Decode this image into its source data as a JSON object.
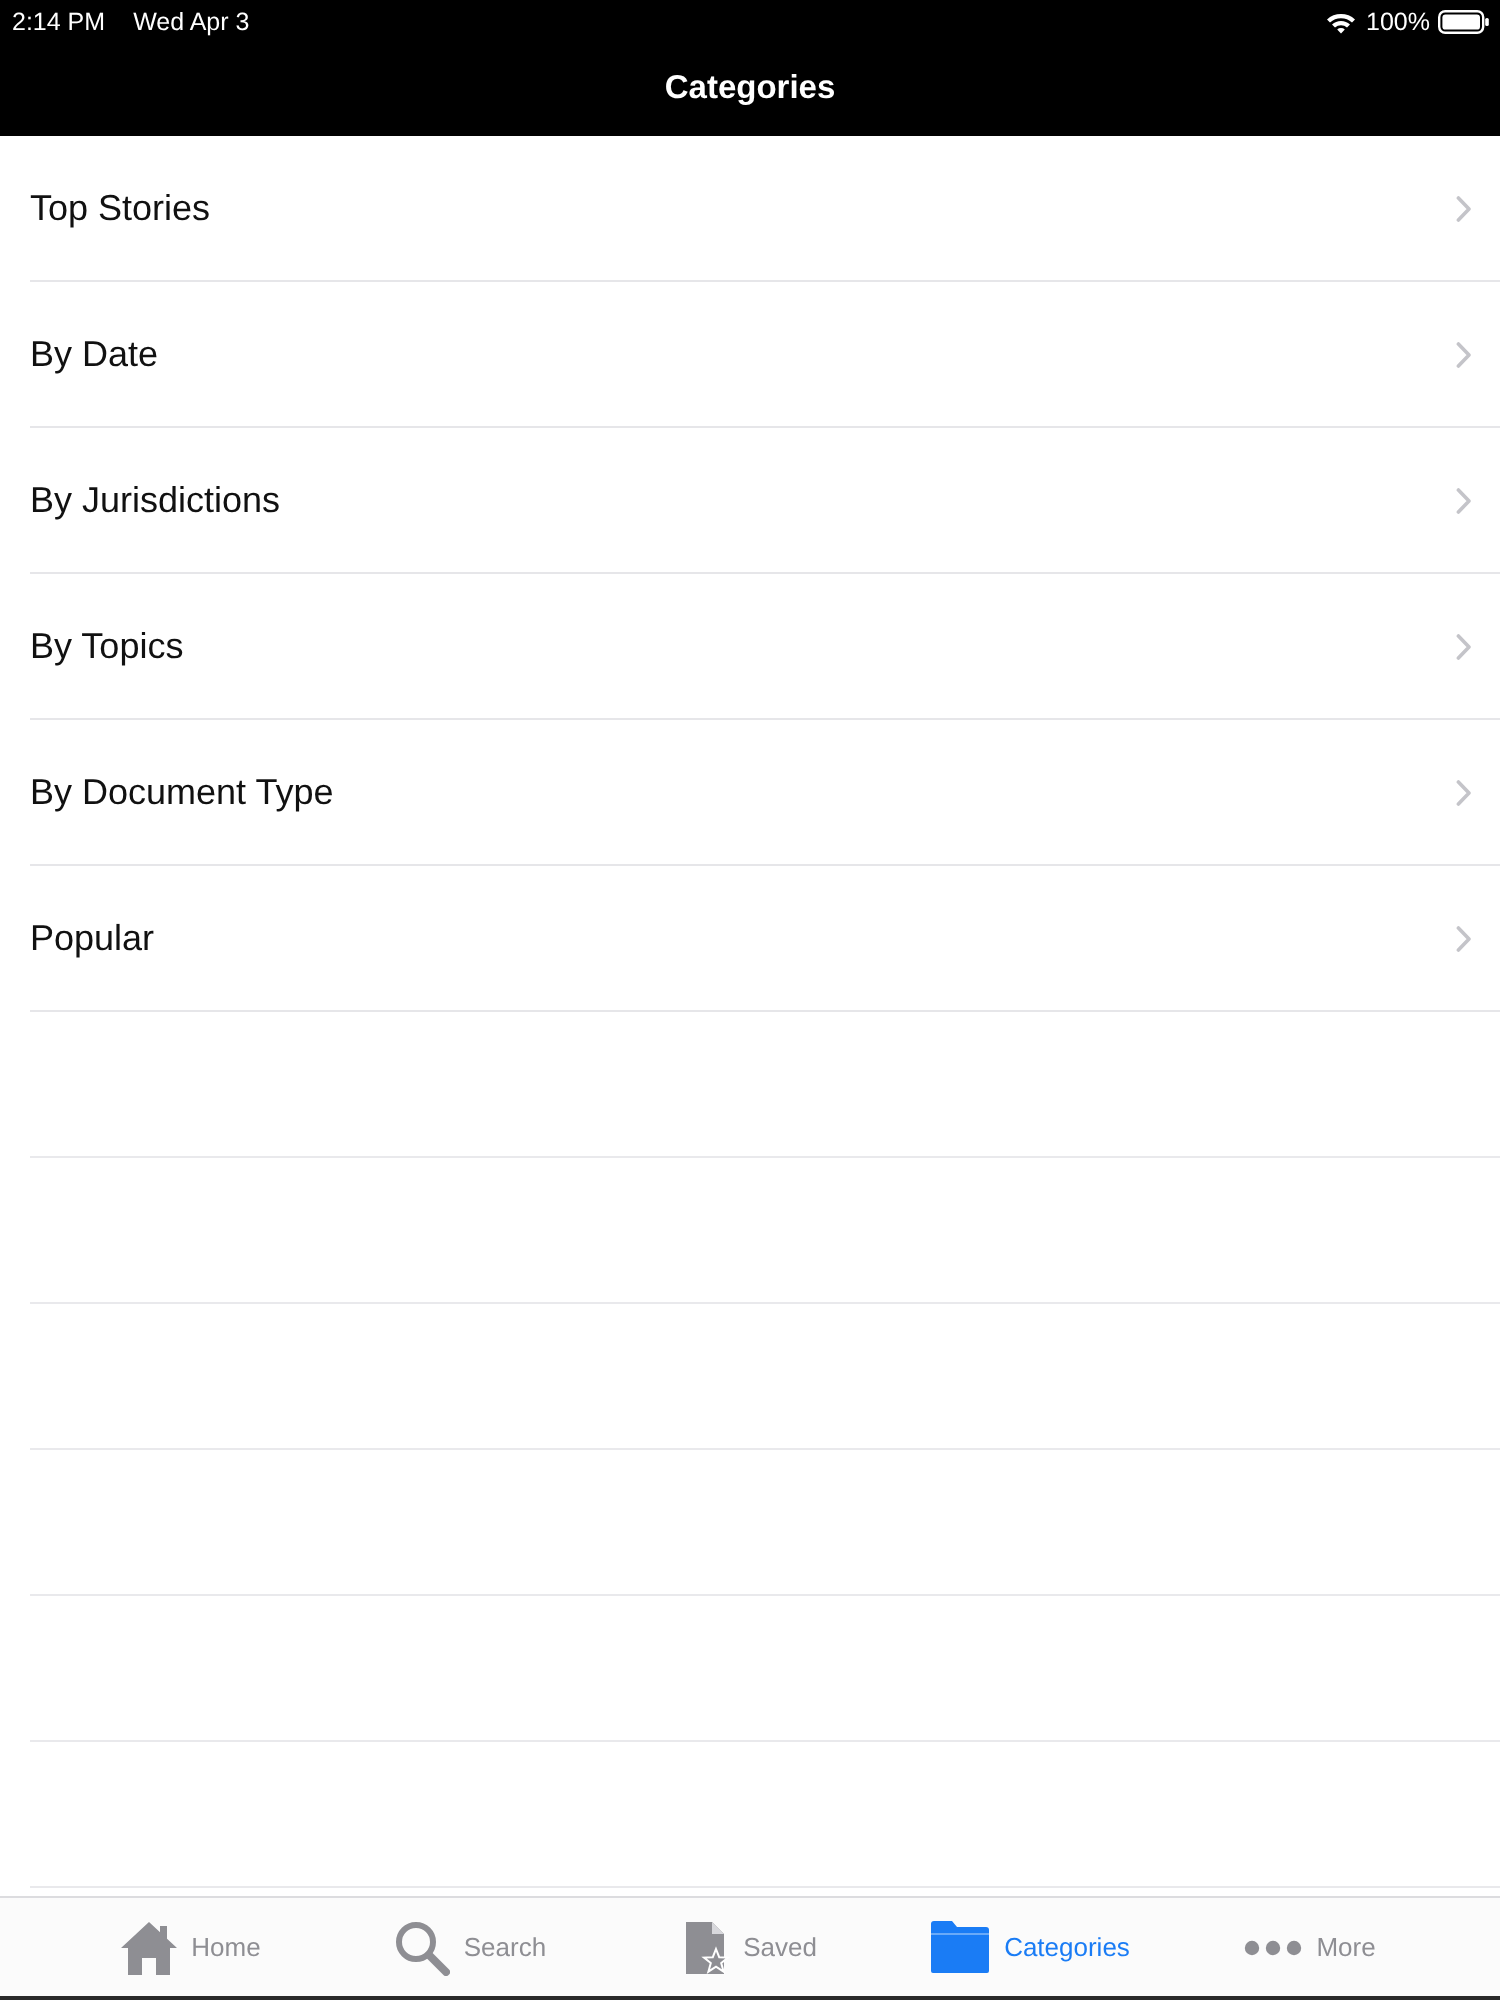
{
  "status_bar": {
    "time": "2:14 PM",
    "date": "Wed Apr 3",
    "battery": "100%"
  },
  "nav_bar": {
    "title": "Categories"
  },
  "list": {
    "items": [
      {
        "label": "Top Stories"
      },
      {
        "label": "By Date"
      },
      {
        "label": "By Jurisdictions"
      },
      {
        "label": "By Topics"
      },
      {
        "label": "By Document Type"
      },
      {
        "label": "Popular"
      }
    ]
  },
  "tab_bar": {
    "tabs": [
      {
        "kind": "home",
        "label": "Home",
        "selected": false
      },
      {
        "kind": "search",
        "label": "Search",
        "selected": false
      },
      {
        "kind": "saved",
        "label": "Saved",
        "selected": false
      },
      {
        "kind": "folder",
        "label": "Categories",
        "selected": true
      },
      {
        "kind": "more",
        "label": "More",
        "selected": false
      }
    ]
  }
}
